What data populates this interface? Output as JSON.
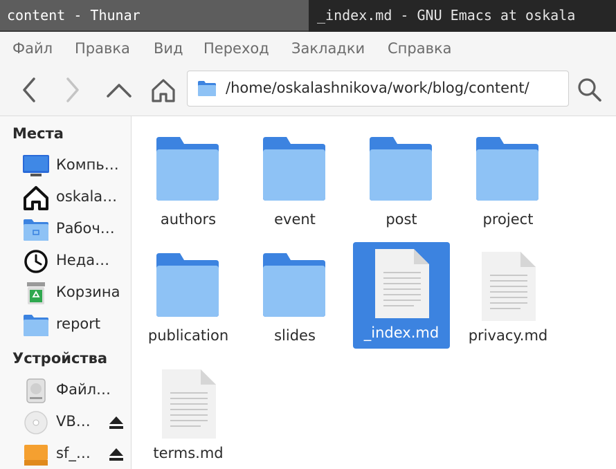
{
  "taskbar": {
    "active_task": "content - Thunar",
    "inactive_task": "_index.md - GNU Emacs at oskala"
  },
  "menubar": {
    "items": [
      "Файл",
      "Правка",
      "Вид",
      "Переход",
      "Закладки",
      "Справка"
    ]
  },
  "toolbar": {
    "back_icon": "chevron-left-icon",
    "forward_icon": "chevron-right-icon",
    "up_icon": "chevron-up-icon",
    "home_icon": "home-icon",
    "path": "/home/oskalashnikova/work/blog/content/",
    "search_icon": "search-icon"
  },
  "sidebar": {
    "places_heading": "Места",
    "places": [
      {
        "label": "Компь…",
        "icon": "computer-icon"
      },
      {
        "label": "oskala…",
        "icon": "home-icon"
      },
      {
        "label": "Рабоч…",
        "icon": "desktop-folder-icon"
      },
      {
        "label": "Неда…",
        "icon": "clock-icon"
      },
      {
        "label": "Корзина",
        "icon": "trash-icon"
      },
      {
        "label": "report",
        "icon": "folder-icon"
      }
    ],
    "devices_heading": "Устройства",
    "devices": [
      {
        "label": "Файл…",
        "icon": "drive-icon"
      },
      {
        "label": "VB…",
        "icon": "disc-icon",
        "eject": true
      },
      {
        "label": "sf_…",
        "icon": "removable-drive-icon",
        "eject": true
      }
    ]
  },
  "files": [
    {
      "name": "authors",
      "type": "folder",
      "selected": false
    },
    {
      "name": "event",
      "type": "folder",
      "selected": false
    },
    {
      "name": "post",
      "type": "folder",
      "selected": false
    },
    {
      "name": "project",
      "type": "folder",
      "selected": false
    },
    {
      "name": "publication",
      "type": "folder",
      "selected": false
    },
    {
      "name": "slides",
      "type": "folder",
      "selected": false
    },
    {
      "name": "_index.md",
      "type": "document",
      "selected": true
    },
    {
      "name": "privacy.md",
      "type": "document",
      "selected": false
    },
    {
      "name": "terms.md",
      "type": "document",
      "selected": false
    }
  ],
  "colors": {
    "folder_back": "#3c83e0",
    "folder_front": "#8ec2f5",
    "selection": "#3c83e0"
  }
}
